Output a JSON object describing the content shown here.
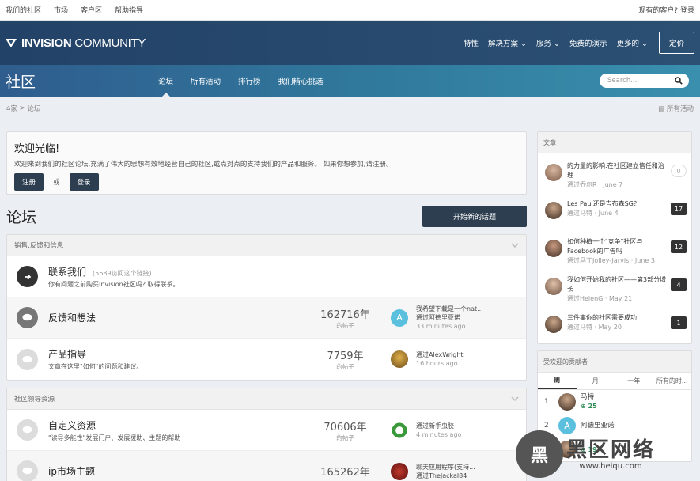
{
  "topbar": {
    "links": [
      "我们的社区",
      "市场",
      "客户区",
      "帮助指导"
    ],
    "account": "现有的客户? 登录"
  },
  "brand": {
    "logo_bold": "INVISION",
    "logo_thin": "COMMUNITY",
    "nav": [
      "特性",
      "解决方案",
      "服务",
      "免费的演示",
      "更多的"
    ],
    "price_button": "定价"
  },
  "community": {
    "title": "社区",
    "tabs": [
      "论坛",
      "所有活动",
      "排行榜",
      "我们精心挑选"
    ],
    "search_placeholder": "Search..."
  },
  "breadcrumb": {
    "home": "家",
    "current": "论坛",
    "all_activity": "所有活动"
  },
  "welcome": {
    "title": "欢迎光临!",
    "text": "欢迎来到我们的社区论坛,充满了伟大的思想有效地经营自己的社区,或点对点的支持我们的产品和服务。 如果你想参加,请注册。",
    "register": "注册",
    "or": "或",
    "login": "登录"
  },
  "forums": {
    "heading": "论坛",
    "new_topic": "开始新的话题",
    "categories": [
      {
        "name": "销售,反馈和信息",
        "rows": [
          {
            "name": "联系我们",
            "extra": "(5689访问这个链接)",
            "desc": "你有问题之前购买Invision社区吗? 取得联系。",
            "posts": "",
            "posts_label": "",
            "last_title": "",
            "last_by": "",
            "last_time": "",
            "icon": "arrow"
          },
          {
            "name": "反馈和想法",
            "extra": "",
            "desc": "",
            "posts": "162716年",
            "posts_label": "的帖子",
            "last_title": "我希望下载是一个nat...",
            "last_by": "通过阿德里亚诺",
            "last_time": "33 minutes ago",
            "icon": "chat"
          },
          {
            "name": "产品指导",
            "extra": "",
            "desc": "文章在这里\"如何\"的问题和建议。",
            "posts": "7759年",
            "posts_label": "的帖子",
            "last_title": "",
            "last_by": "通过AlexWright",
            "last_time": "16 hours ago",
            "icon": "chat"
          }
        ]
      },
      {
        "name": "社区领导资源",
        "rows": [
          {
            "name": "自定义资源",
            "extra": "",
            "desc": "\"读导多能性\"发展门户、发展援助、主题的帮助",
            "posts": "70606年",
            "posts_label": "的帖子",
            "last_title": "",
            "last_by": "通过新手虫胶",
            "last_time": "4 minutes ago",
            "icon": "chat"
          },
          {
            "name": "ip市场主题",
            "extra": "",
            "desc": "",
            "posts": "165262年",
            "posts_label": "",
            "last_title": "聊天应用程序(支持...",
            "last_by": "通过TheJackal84",
            "last_time": "",
            "icon": "chat"
          }
        ]
      }
    ]
  },
  "articles": {
    "heading": "文章",
    "items": [
      {
        "title": "的力量的影响:在社区建立信任和治理",
        "meta": "通过乔尔R",
        "date": "June 7",
        "count": "0"
      },
      {
        "title": "Les Paul还是吉布森SG？",
        "meta": "通过马特",
        "date": "June 4",
        "count": "17"
      },
      {
        "title": "如何种植一个\"竞争\"社区与Facebook的广告吗",
        "meta": "通过马丁Jolley-Jarvis",
        "date": "June 3",
        "count": "12"
      },
      {
        "title": "我如何开始我的社区——第3部分增长",
        "meta": "通过HelenG",
        "date": "May 21",
        "count": "4"
      },
      {
        "title": "三件事你的社区需要成功",
        "meta": "通过马特",
        "date": "May 20",
        "count": "1"
      }
    ]
  },
  "contributors": {
    "heading": "受欢迎的贡献者",
    "tabs": [
      "周",
      "月",
      "一年",
      "所有的时..."
    ],
    "items": [
      {
        "rank": "1",
        "name": "马特",
        "rep": "25"
      },
      {
        "rank": "2",
        "name": "阿德里亚诺",
        "rep": ""
      },
      {
        "rank": "3",
        "name": "",
        "rep": "19"
      }
    ]
  },
  "watermark": {
    "badge": "黑",
    "text": "黑区网络",
    "url": "www.heiqu.com"
  },
  "colors": {
    "brand_dark": "#234268",
    "nav_blue": "#307a9d",
    "button_dark": "#2c3e50",
    "rep_green": "#2e8b57"
  }
}
